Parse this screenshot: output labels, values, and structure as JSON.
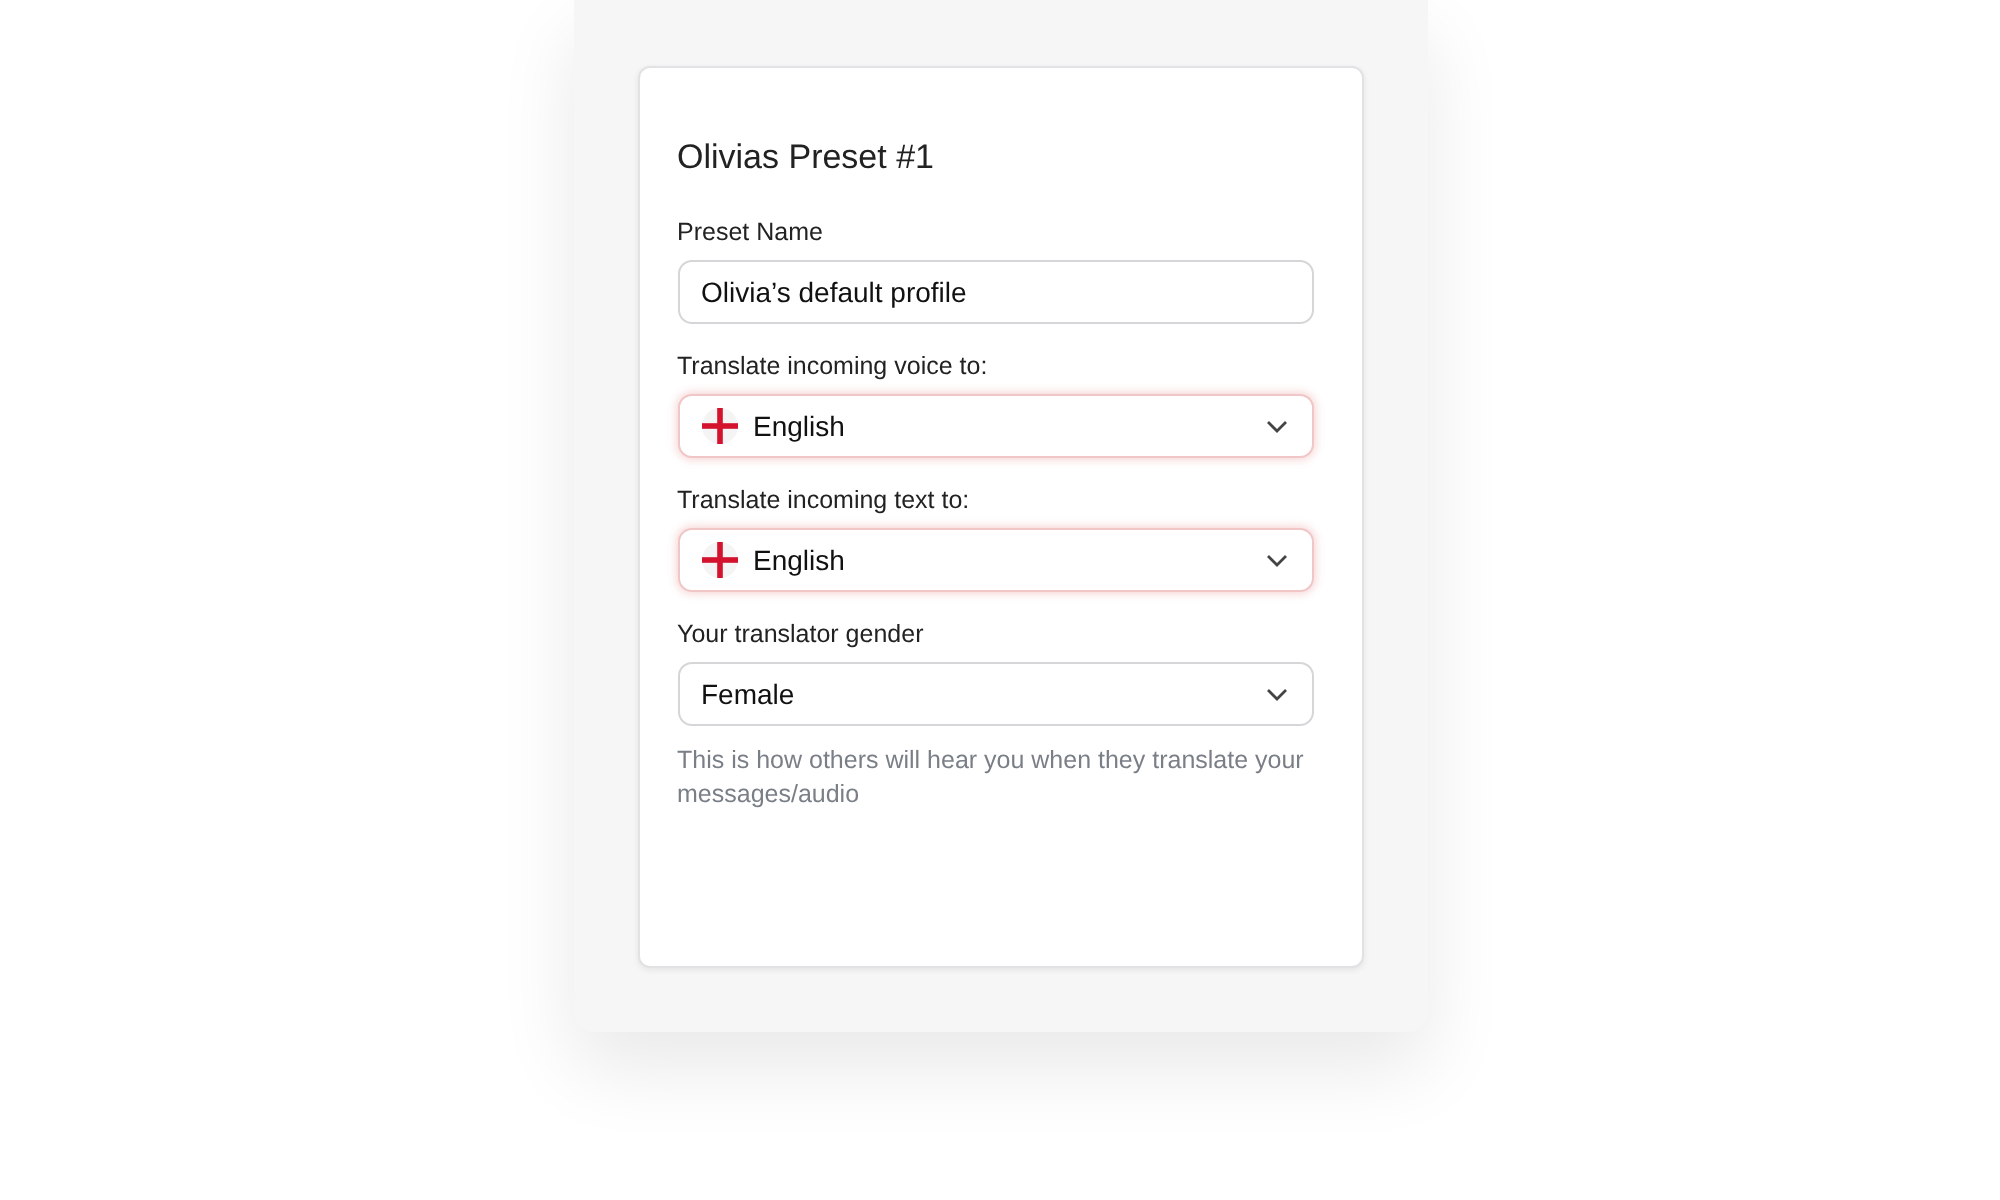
{
  "card": {
    "title": "Olivias Preset #1",
    "fields": [
      {
        "kind": "text",
        "label": "Preset Name",
        "value": "Olivia’s default profile",
        "highlighted": false,
        "flag": false
      },
      {
        "kind": "select",
        "label": "Translate incoming voice to:",
        "value": "English",
        "highlighted": true,
        "flag": true
      },
      {
        "kind": "select",
        "label": "Translate incoming text to:",
        "value": "English",
        "highlighted": true,
        "flag": true
      },
      {
        "kind": "select",
        "label": "Your translator gender",
        "value": "Female",
        "highlighted": false,
        "flag": false,
        "hint": "This is how others will hear you when they translate your messages/audio"
      }
    ]
  }
}
